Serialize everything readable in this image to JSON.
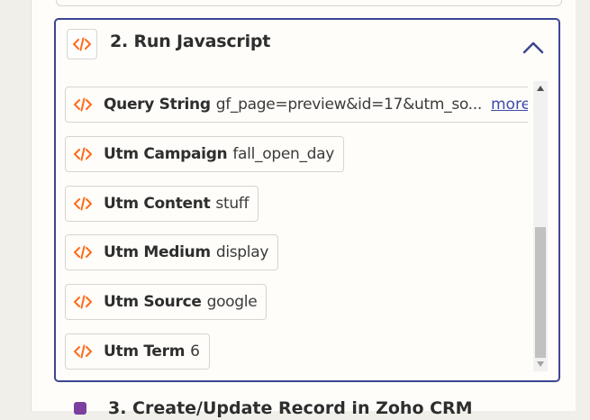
{
  "step": {
    "title": "2. Run Javascript",
    "icon": "code-icon",
    "collapse_icon": "chevron-up-icon"
  },
  "fields": [
    {
      "name": "Query String",
      "value": "gf_page=preview&id=17&utm_so...",
      "more": "more"
    },
    {
      "name": "Utm Campaign",
      "value": "fall_open_day"
    },
    {
      "name": "Utm Content",
      "value": "stuff"
    },
    {
      "name": "Utm Medium",
      "value": "display"
    },
    {
      "name": "Utm Source",
      "value": "google"
    },
    {
      "name": "Utm Term",
      "value": "6"
    }
  ],
  "next_step": {
    "title": "3. Create/Update Record in Zoho CRM"
  },
  "colors": {
    "accent": "#3d4592",
    "code_icon": "#ff6a1a",
    "link": "#3d4ab0",
    "next_step_icon": "#7b3fa0"
  }
}
